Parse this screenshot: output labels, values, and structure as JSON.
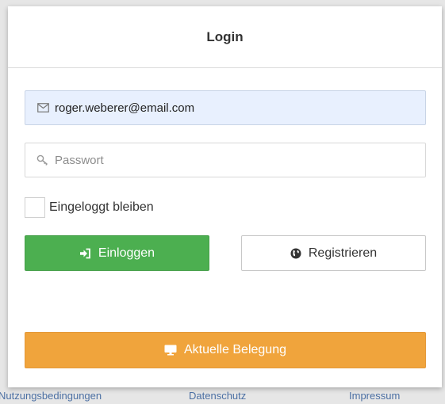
{
  "login": {
    "title": "Login",
    "email_value": "roger.weberer@email.com",
    "password_placeholder": "Passwort",
    "remember_label": "Eingeloggt bleiben",
    "login_button": "Einloggen",
    "register_button": "Registrieren",
    "occupancy_button": "Aktuelle Belegung"
  },
  "footer": {
    "links": [
      "Nutzungsbedingungen",
      "Datenschutz",
      "Impressum"
    ]
  },
  "icons": {
    "email": "envelope-icon",
    "password": "key-icon",
    "login": "sign-in-icon",
    "register": "globe-icon",
    "occupancy": "monitor-icon"
  },
  "colors": {
    "login_button": "#4caf50",
    "occupancy_button": "#f0a43c",
    "email_field_bg": "#e8f0fe",
    "footer_link": "#4b6fa3"
  }
}
